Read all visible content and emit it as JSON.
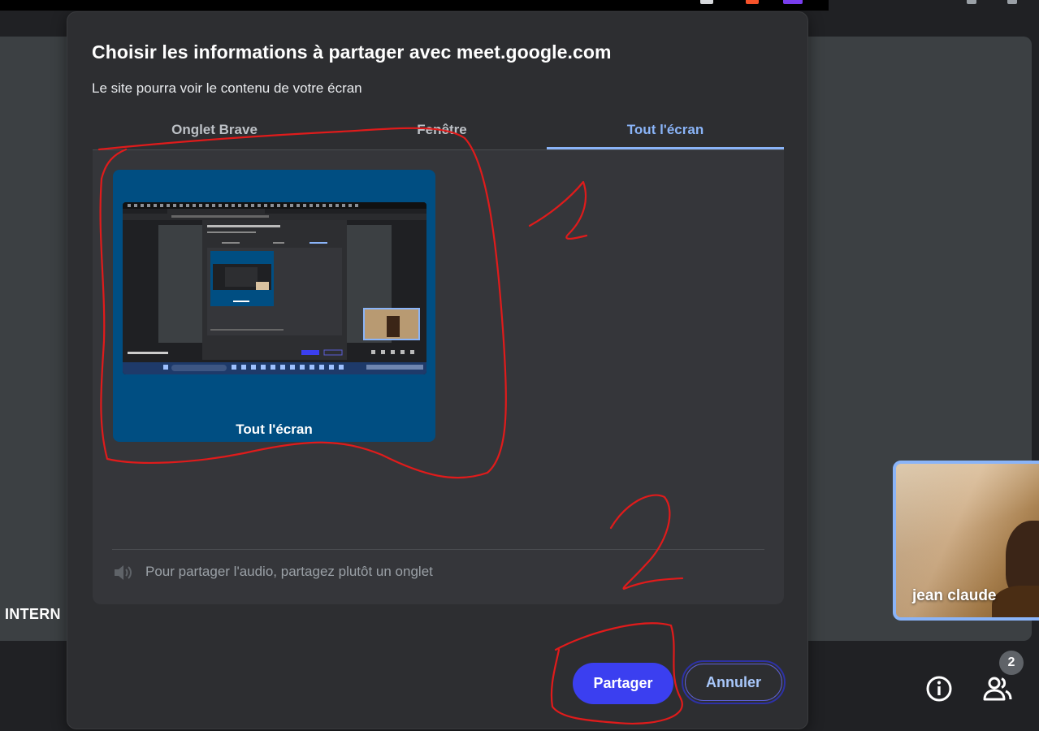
{
  "background": {
    "participant_tile_name": "INTERN",
    "self_view_name": "jean claude",
    "people_count": "2",
    "controls": {
      "info_icon": "info-icon",
      "people_icon": "people-icon"
    }
  },
  "dialog": {
    "title": "Choisir les informations à partager avec meet.google.com",
    "subtitle": "Le site pourra voir le contenu de votre écran",
    "tabs": [
      {
        "label": "Onglet Brave",
        "selected": false
      },
      {
        "label": "Fenêtre",
        "selected": false
      },
      {
        "label": "Tout l'écran",
        "selected": true
      }
    ],
    "sources": [
      {
        "label": "Tout l'écran",
        "selected": true
      }
    ],
    "audio_note": "Pour partager l'audio, partagez plutôt un onglet",
    "audio_icon": "speaker-icon",
    "buttons": {
      "share": "Partager",
      "cancel": "Annuler"
    }
  },
  "annotations": {
    "marker_1": "1",
    "marker_2": "2",
    "ink_color": "#e01b1b"
  },
  "colors": {
    "accent": "#8ab4f8",
    "share_button": "#3b3ff0",
    "source_card": "#004e82",
    "dialog_bg": "#2d2e31",
    "panel_bg": "#35363a"
  }
}
